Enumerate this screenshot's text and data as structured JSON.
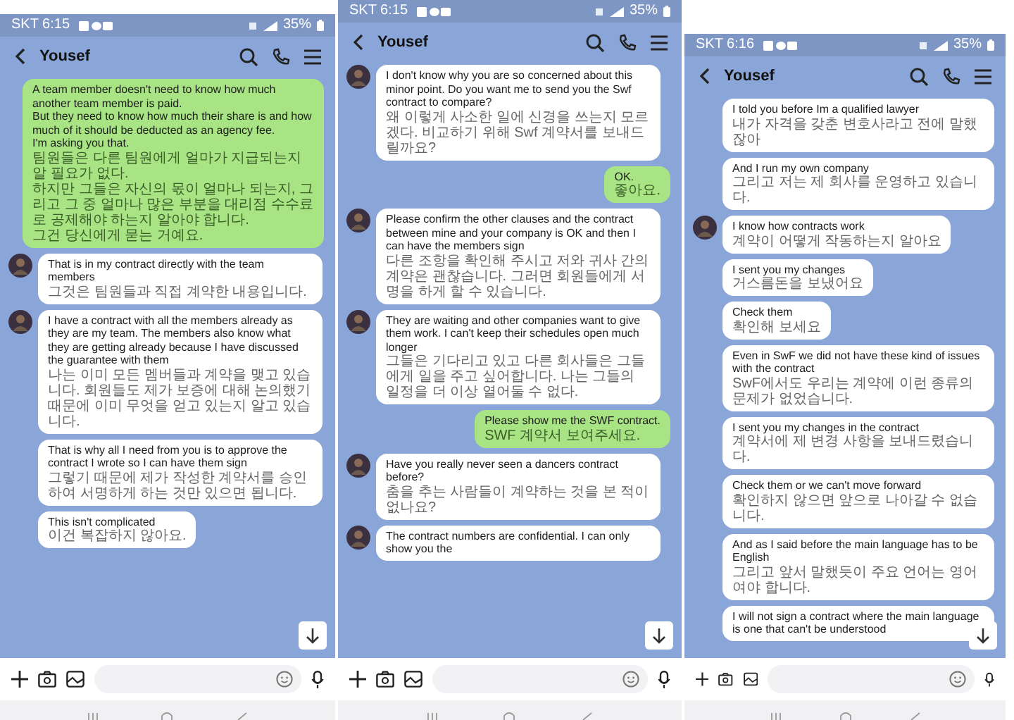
{
  "panels": [
    {
      "status_bar": {
        "text": "SKT 6:15",
        "battery": "35%"
      },
      "header": {
        "title": "Yousef"
      },
      "messages": [
        {
          "kind": "sent",
          "text": "A team member doesn't need to know how much another team member is paid.\nBut they need to know how much their share is and how much of it should be deducted as an agency fee.\nI'm asking you that.",
          "translation": "팀원들은 다른 팀원에게 얼마가 지급되는지 알 필요가 없다.\n하지만 그들은 자신의 몫이 얼마나 되는지, 그리고 그 중 얼마나 많은 부분을 대리점 수수료로 공제해야 하는지 알아야 합니다.\n그건 당신에게 묻는 거예요."
        },
        {
          "kind": "received",
          "avatar": true,
          "text": "That is in my contract directly with the team members",
          "translation": "그것은 팀원들과 직접 계약한 내용입니다."
        },
        {
          "kind": "received",
          "avatar": true,
          "text": "I have a contract with all the members already as they are my team. The members also know what they are getting already because I have discussed the guarantee with them",
          "translation": "나는 이미 모든 멤버들과 계약을 맺고 있습니다. 회원들도 제가 보증에 대해 논의했기 때문에 이미 무엇을 얻고 있는지 알고 있습니다."
        },
        {
          "kind": "received",
          "avatar": false,
          "text": "That is why all I need from you is to approve the contract I wrote so I can have them sign",
          "translation": "그렇기 때문에 제가 작성한 계약서를 승인하여 서명하게 하는 것만 있으면 됩니다."
        },
        {
          "kind": "received",
          "avatar": false,
          "text": "This isn't complicated",
          "translation": "이건 복잡하지 않아요."
        }
      ]
    },
    {
      "status_bar": {
        "text": "SKT 6:15",
        "battery": "35%"
      },
      "header": {
        "title": "Yousef"
      },
      "messages": [
        {
          "kind": "received",
          "avatar": true,
          "text": "I don't know why you are so concerned about this minor point. Do you want me to send you the Swf contract to compare?",
          "translation": "왜 이렇게 사소한 일에 신경을 쓰는지 모르겠다. 비교하기 위해 Swf 계약서를 보내드릴까요?"
        },
        {
          "kind": "sent",
          "text": "OK.",
          "translation": "좋아요."
        },
        {
          "kind": "received",
          "avatar": true,
          "text": "Please confirm the other clauses and the contract between mine and your company is OK and then I can have the members sign",
          "translation": "다른 조항을 확인해 주시고 저와 귀사 간의 계약은 괜찮습니다. 그러면 회원들에게 서명을 하게 할 수 있습니다."
        },
        {
          "kind": "received",
          "avatar": true,
          "text": "They are waiting and other companies want to give them work. I can't keep their schedules open much longer",
          "translation": "그들은 기다리고 있고 다른 회사들은 그들에게 일을 주고 싶어합니다. 나는 그들의 일정을 더 이상 열어둘 수 없다."
        },
        {
          "kind": "sent",
          "text": "Please show me the SWF contract.",
          "translation": "SWF 계약서 보여주세요."
        },
        {
          "kind": "received",
          "avatar": true,
          "text": "Have you really never seen a dancers contract before?",
          "translation": "춤을 추는 사람들이 계약하는 것을 본 적이 없나요?"
        },
        {
          "kind": "received",
          "avatar": true,
          "text": "The contract numbers are confidential. I can only show you the"
        }
      ]
    },
    {
      "status_bar": {
        "text": "SKT 6:16",
        "battery": "35%"
      },
      "header": {
        "title": "Yousef"
      },
      "messages": [
        {
          "kind": "received",
          "avatar": false,
          "text": "I told you before Im a qualified lawyer",
          "translation": "내가 자격을 갖춘 변호사라고 전에 말했잖아"
        },
        {
          "kind": "received",
          "avatar": false,
          "text": "And I run my own company",
          "translation": "그리고 저는 제 회사를 운영하고 있습니다."
        },
        {
          "kind": "received",
          "avatar": true,
          "text": "I know how contracts work",
          "translation": "계약이 어떻게 작동하는지 알아요"
        },
        {
          "kind": "received",
          "avatar": false,
          "text": "I sent you my changes",
          "translation": "거스름돈을 보냈어요"
        },
        {
          "kind": "received",
          "avatar": false,
          "text": "Check them",
          "translation": "확인해 보세요"
        },
        {
          "kind": "received",
          "avatar": false,
          "text": "Even in SwF we did not have these kind of issues with the contract",
          "translation": "SwF에서도 우리는 계약에 이런 종류의 문제가 없었습니다."
        },
        {
          "kind": "received",
          "avatar": false,
          "text": "I sent you my changes in the contract",
          "translation": "계약서에 제 변경 사항을 보내드렸습니다."
        },
        {
          "kind": "received",
          "avatar": false,
          "text": "Check them or we can't move forward",
          "translation": "확인하지 않으면 앞으로 나아갈 수 없습니다."
        },
        {
          "kind": "received",
          "avatar": false,
          "text": "And as I said before the main language has to be English",
          "translation": "그리고 앞서 말했듯이 주요 언어는 영어여야 합니다."
        },
        {
          "kind": "received",
          "avatar": false,
          "text": "I will not sign a contract where the main language is one that can't be understood"
        }
      ]
    }
  ]
}
